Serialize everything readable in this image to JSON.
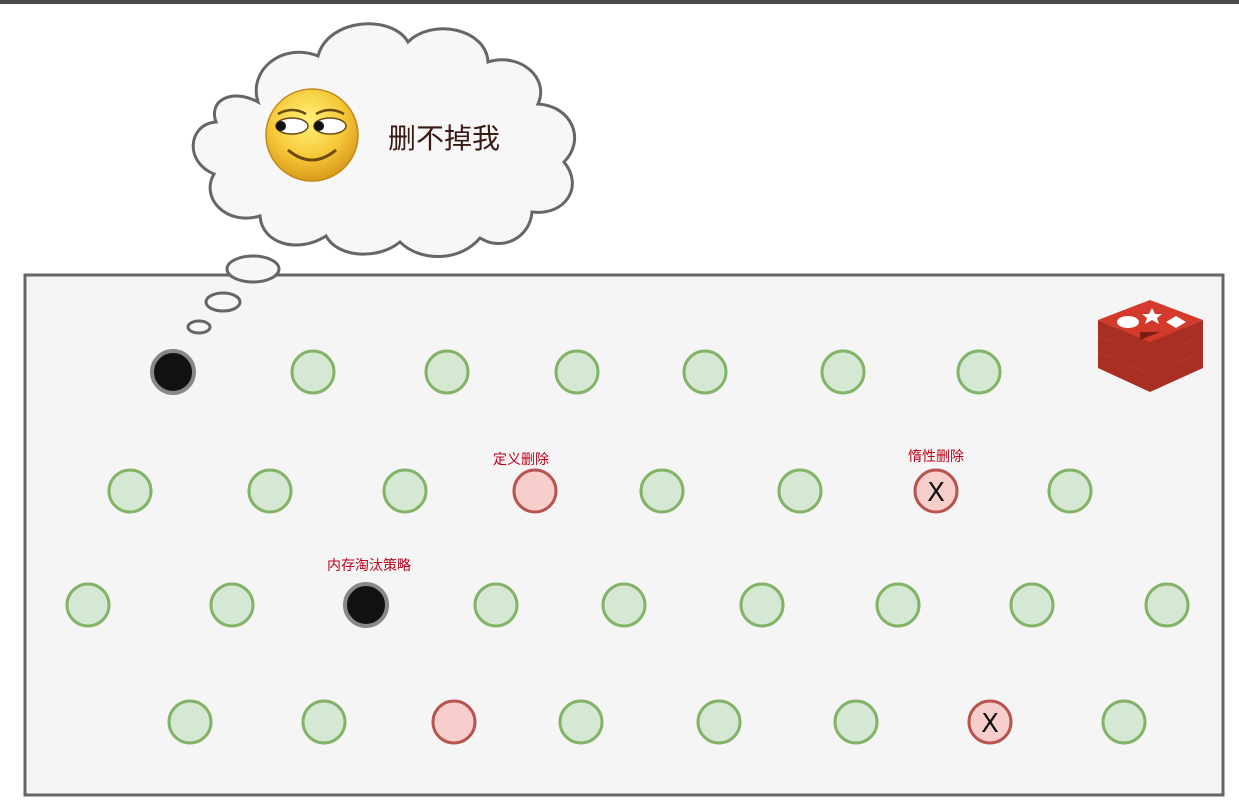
{
  "thought_bubble": {
    "text": "删不掉我",
    "emoji_icon": "smirking-face-icon"
  },
  "labels": {
    "define_delete": "定义删除",
    "lazy_delete": "惰性删除",
    "memory_eviction": "内存淘汰策略"
  },
  "x_symbol": "X",
  "logo": {
    "icon": "redis-logo-icon",
    "color": "#d33a2c"
  },
  "colors": {
    "normal_fill": "#d5e8d4",
    "normal_stroke": "#82b366",
    "deleted_fill": "#f8cecc",
    "deleted_stroke": "#b85450",
    "evicted_fill": "#111111",
    "evicted_stroke": "#888888",
    "box_fill": "#f5f5f5",
    "box_stroke": "#666666"
  },
  "rows": [
    {
      "keys": [
        "evicted",
        "normal",
        "normal",
        "normal",
        "normal",
        "normal",
        "normal"
      ]
    },
    {
      "keys": [
        "normal",
        "normal",
        "normal",
        "deleted",
        "normal",
        "normal",
        "deleted-x",
        "normal"
      ]
    },
    {
      "keys": [
        "normal",
        "normal",
        "evicted",
        "normal",
        "normal",
        "normal",
        "normal",
        "normal",
        "normal"
      ]
    },
    {
      "keys": [
        "normal",
        "normal",
        "deleted",
        "normal",
        "normal",
        "normal",
        "deleted-x",
        "normal"
      ]
    }
  ]
}
